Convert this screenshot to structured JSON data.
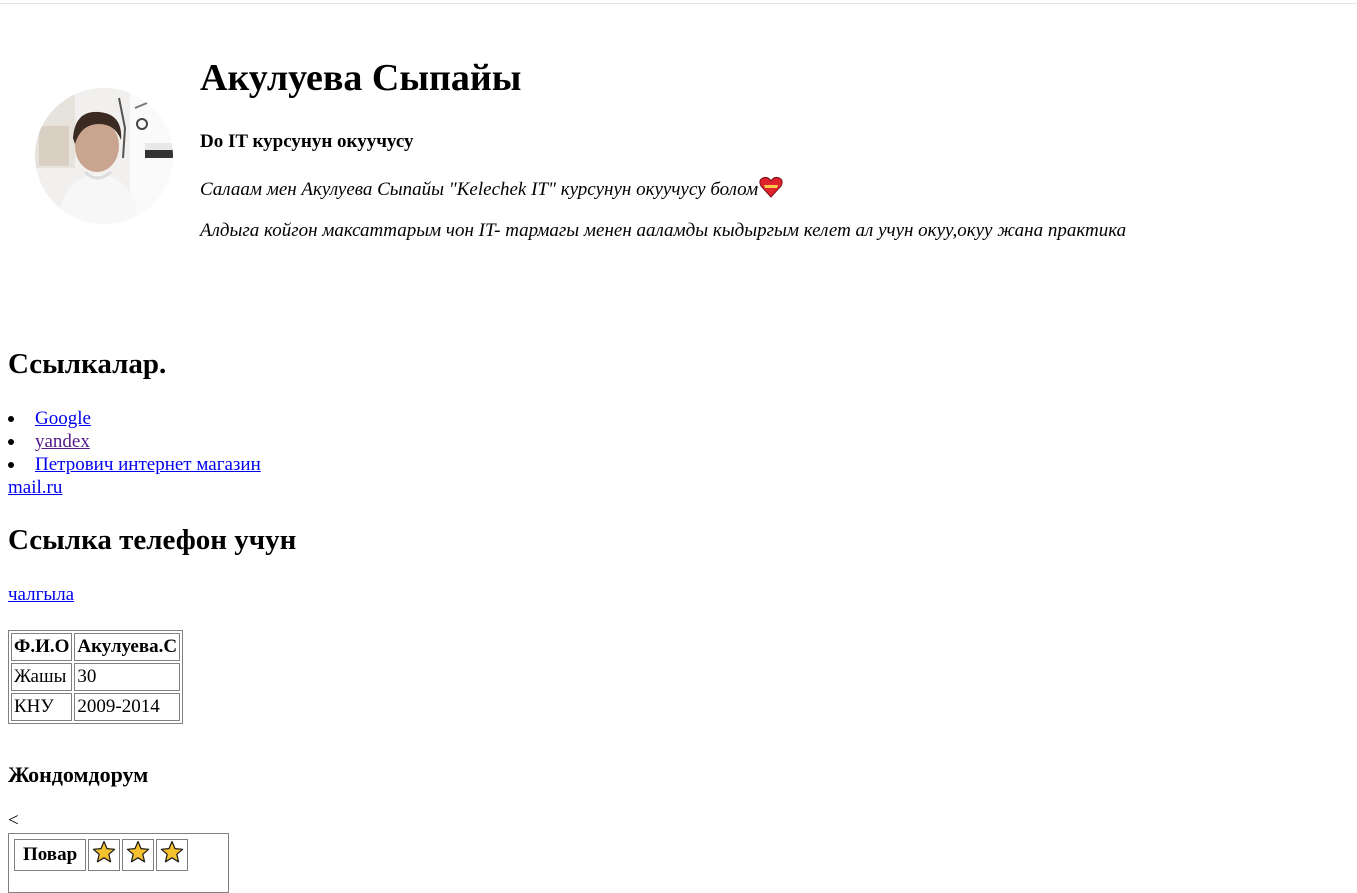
{
  "profile": {
    "name": "Акулуева Сыпайы",
    "subtitle": "Do IT курсунун окуучусу",
    "paragraph1": "Салаам мен Акулуева Сыпайы \"Kelechek IT\" курсунун окуучусу болом",
    "paragraph2": "Алдыга койгон максаттарым чон IT- тармагы менен ааламды кыдыргым келет ал учун окуу,окуу жана практика",
    "avatar_icon": "profile-photo",
    "heart_icon": "heart-emoji"
  },
  "links": {
    "heading": "Ссылкалар.",
    "items": [
      {
        "label": "Google",
        "visited": false
      },
      {
        "label": "yandex",
        "visited": true
      },
      {
        "label": "Петрович интернет магазин",
        "visited": false
      }
    ],
    "mail_label": "mail.ru"
  },
  "phone": {
    "heading": "Ссылка телефон учун",
    "call_label": "чалгыла"
  },
  "info_table": {
    "header": [
      "Ф.И.О",
      "Акулуева.С"
    ],
    "rows": [
      [
        "Жашы",
        "30"
      ],
      [
        "КНУ",
        "2009-2014"
      ]
    ]
  },
  "skills": {
    "heading": "Жондомдорум",
    "stray_text": "<",
    "rows": [
      {
        "label": "Повар",
        "stars": 3
      }
    ]
  },
  "colors": {
    "link": "#0000ee",
    "visited_link": "#551a8b",
    "star_fill": "#f5c12e",
    "star_stroke": "#1a1a1a",
    "heart_red": "#e0242e"
  }
}
